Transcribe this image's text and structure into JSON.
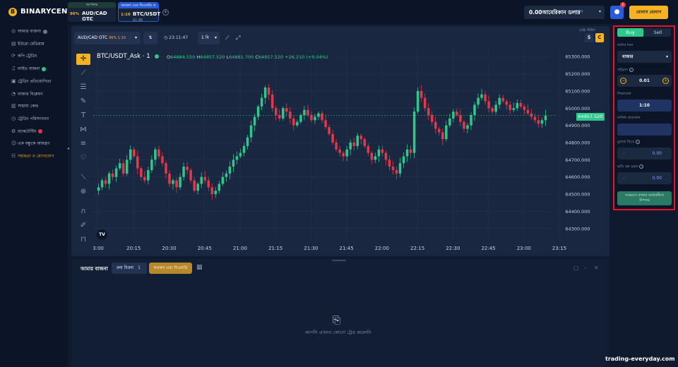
{
  "brand": {
    "logo_mark": "B",
    "name": "BINARYCENT"
  },
  "asset_tabs": [
    {
      "header": "আপনার",
      "percent": "96%",
      "name": "AUD/CAD OTC",
      "sub": "$1.13",
      "header_color": "#1f3b36"
    },
    {
      "header": "কতক্ষণ এবং সিএফডি ×",
      "percent": "1:10",
      "name": "BTC/USDT",
      "sub": "$1.86",
      "header_color": "#2a5bd7"
    }
  ],
  "add_tab_icon": "plus-icon",
  "balance": {
    "amount": "0.00আমেরিকান ডলার",
    "account": "বাস্তব",
    "caret": "▾"
  },
  "notifications_count": "1",
  "bonus_button": "বোনাস বোনাস",
  "sidebar": {
    "items": [
      {
        "label": "আমার বাজনা",
        "icon": "◎",
        "badge": "#6b7a93",
        "gold": false
      },
      {
        "label": "ইউরো মেডিয়াম",
        "icon": "▤",
        "gold": false
      },
      {
        "label": "কপি ট্রেডিং",
        "icon": "⟳",
        "gold": false
      },
      {
        "label": "লাইভ বাজনা",
        "icon": "♫",
        "badge": "#2fc88a",
        "gold": false
      },
      {
        "label": "ট্রেডিং প্রতিযোগিতা",
        "icon": "▣",
        "gold": false
      },
      {
        "label": "বাজার বিশ্লেষণ",
        "icon": "◔",
        "gold": false
      },
      {
        "label": "সাহায্য কেন্দ্র",
        "icon": "▥",
        "gold": false
      },
      {
        "label": "ট্রেডিং পরিসংখ্যান",
        "icon": "◷",
        "gold": false
      },
      {
        "label": "ব্যাকটেস্টিং",
        "icon": "⚙",
        "badge": "#e5374a",
        "gold": false
      },
      {
        "label": "এক বন্ধুকে আমন্ত্রণ",
        "icon": "☺",
        "gold": false
      },
      {
        "label": "সহায়তা ও যোগাযোগ",
        "icon": "☷",
        "gold": true
      }
    ]
  },
  "chart_toolbar": {
    "symbol": "AUD/CAD OTC",
    "symbol_pct": "96% 1:10",
    "timer": "23:11:47",
    "timeframe": "1 মি",
    "currency_dollar": "$",
    "currency_c": "C",
    "corner_label": "চেঞ্জ স্টাইল"
  },
  "chart_data": {
    "type": "candlestick",
    "symbol_label": "BTC/USDT_Ask · 1",
    "ohlc": {
      "o_label": "O",
      "o": "64884.550",
      "h_label": "H",
      "h": "64957.520",
      "l_label": "L",
      "l": "64881.700",
      "c_label": "C",
      "c": "64957.520",
      "change": "+26.210 (+0.04%)"
    },
    "current_price": "64957.520",
    "ylim": [
      64250,
      65350
    ],
    "yticks": [
      "65300.000",
      "65200.000",
      "65100.000",
      "65000.000",
      "64900.000",
      "64800.000",
      "64700.000",
      "64600.000",
      "64500.000",
      "64400.000",
      "64300.000"
    ],
    "xticks": [
      "3:00",
      "20:15",
      "20:30",
      "20:45",
      "21:00",
      "21:15",
      "21:30",
      "21:45",
      "22:00",
      "22:15",
      "22:30",
      "22:45",
      "23:00",
      "23:15"
    ],
    "grid": true,
    "closes": [
      64540,
      64580,
      64560,
      64620,
      64600,
      64650,
      64680,
      64620,
      64700,
      64760,
      64720,
      64650,
      64600,
      64580,
      64640,
      64700,
      64760,
      64720,
      64680,
      64620,
      64560,
      64580,
      64540,
      64600,
      64660,
      64640,
      64580,
      64520,
      64560,
      64600,
      64580,
      64540,
      64500,
      64520,
      64560,
      64600,
      64620,
      64660,
      64700,
      64720,
      64740,
      64780,
      64830,
      64900,
      64950,
      65010,
      65060,
      65120,
      65080,
      65000,
      64960,
      64940,
      65000,
      64980,
      64940,
      64900,
      64920,
      64960,
      64990,
      64960,
      64930,
      64950,
      64970,
      64930,
      64890,
      64850,
      64800,
      64760,
      64740,
      64720,
      64760,
      64800,
      64780,
      64840,
      64820,
      64780,
      64740,
      64700,
      64720,
      64760,
      64740,
      64700,
      64660,
      64640,
      64620,
      64680,
      64720,
      64760,
      64740,
      64980,
      65100,
      65060,
      65000,
      64960,
      64920,
      64880,
      64860,
      64820,
      64900,
      64940,
      64980,
      64960,
      64920,
      64880,
      64900,
      64960,
      65020,
      65060,
      65080,
      65040,
      65000,
      64980,
      65020,
      65060,
      65040,
      65020,
      64990,
      65000,
      65030,
      65010,
      64990,
      64970,
      64950,
      64930,
      64910,
      64930,
      64957.52
    ]
  },
  "bottom_panel": {
    "title": "আমার বাজনা",
    "tab1_label": "ক্রয় বিক্রয়",
    "tab1_count": "1",
    "tab2_label": "কতক্ষণ এবং সিএফডি",
    "empty_message": "আপনি এখনও কোনো ট্রেড করেননি"
  },
  "trade_panel": {
    "buy": "Buy",
    "sell": "Sell",
    "order_type_label": "অর্ডার ধরন",
    "order_type_value": "বাজার",
    "amount_label": "পরিমাণ",
    "amount_value": "0.01",
    "leverage_label": "লিভারেজ",
    "leverage_value": "1:10",
    "margin_label": "মার্জিন প্রয়োজন",
    "take_profit_label": "মুনাফা নিতে",
    "take_profit_value": "0.00",
    "stop_loss_label": "ক্ষতি বন্ধ করুন",
    "stop_loss_value": "0.00",
    "dash": "-",
    "place_button_line1": "সংস্করণে বাজার অর্ডারটিতে",
    "place_button_line2": "উপলব্ধ"
  },
  "watermark": "trading-everyday.com",
  "colors": {
    "up": "#2fc88a",
    "down": "#e5374a",
    "accent": "#f5b324",
    "highlight": "#e8122a"
  }
}
